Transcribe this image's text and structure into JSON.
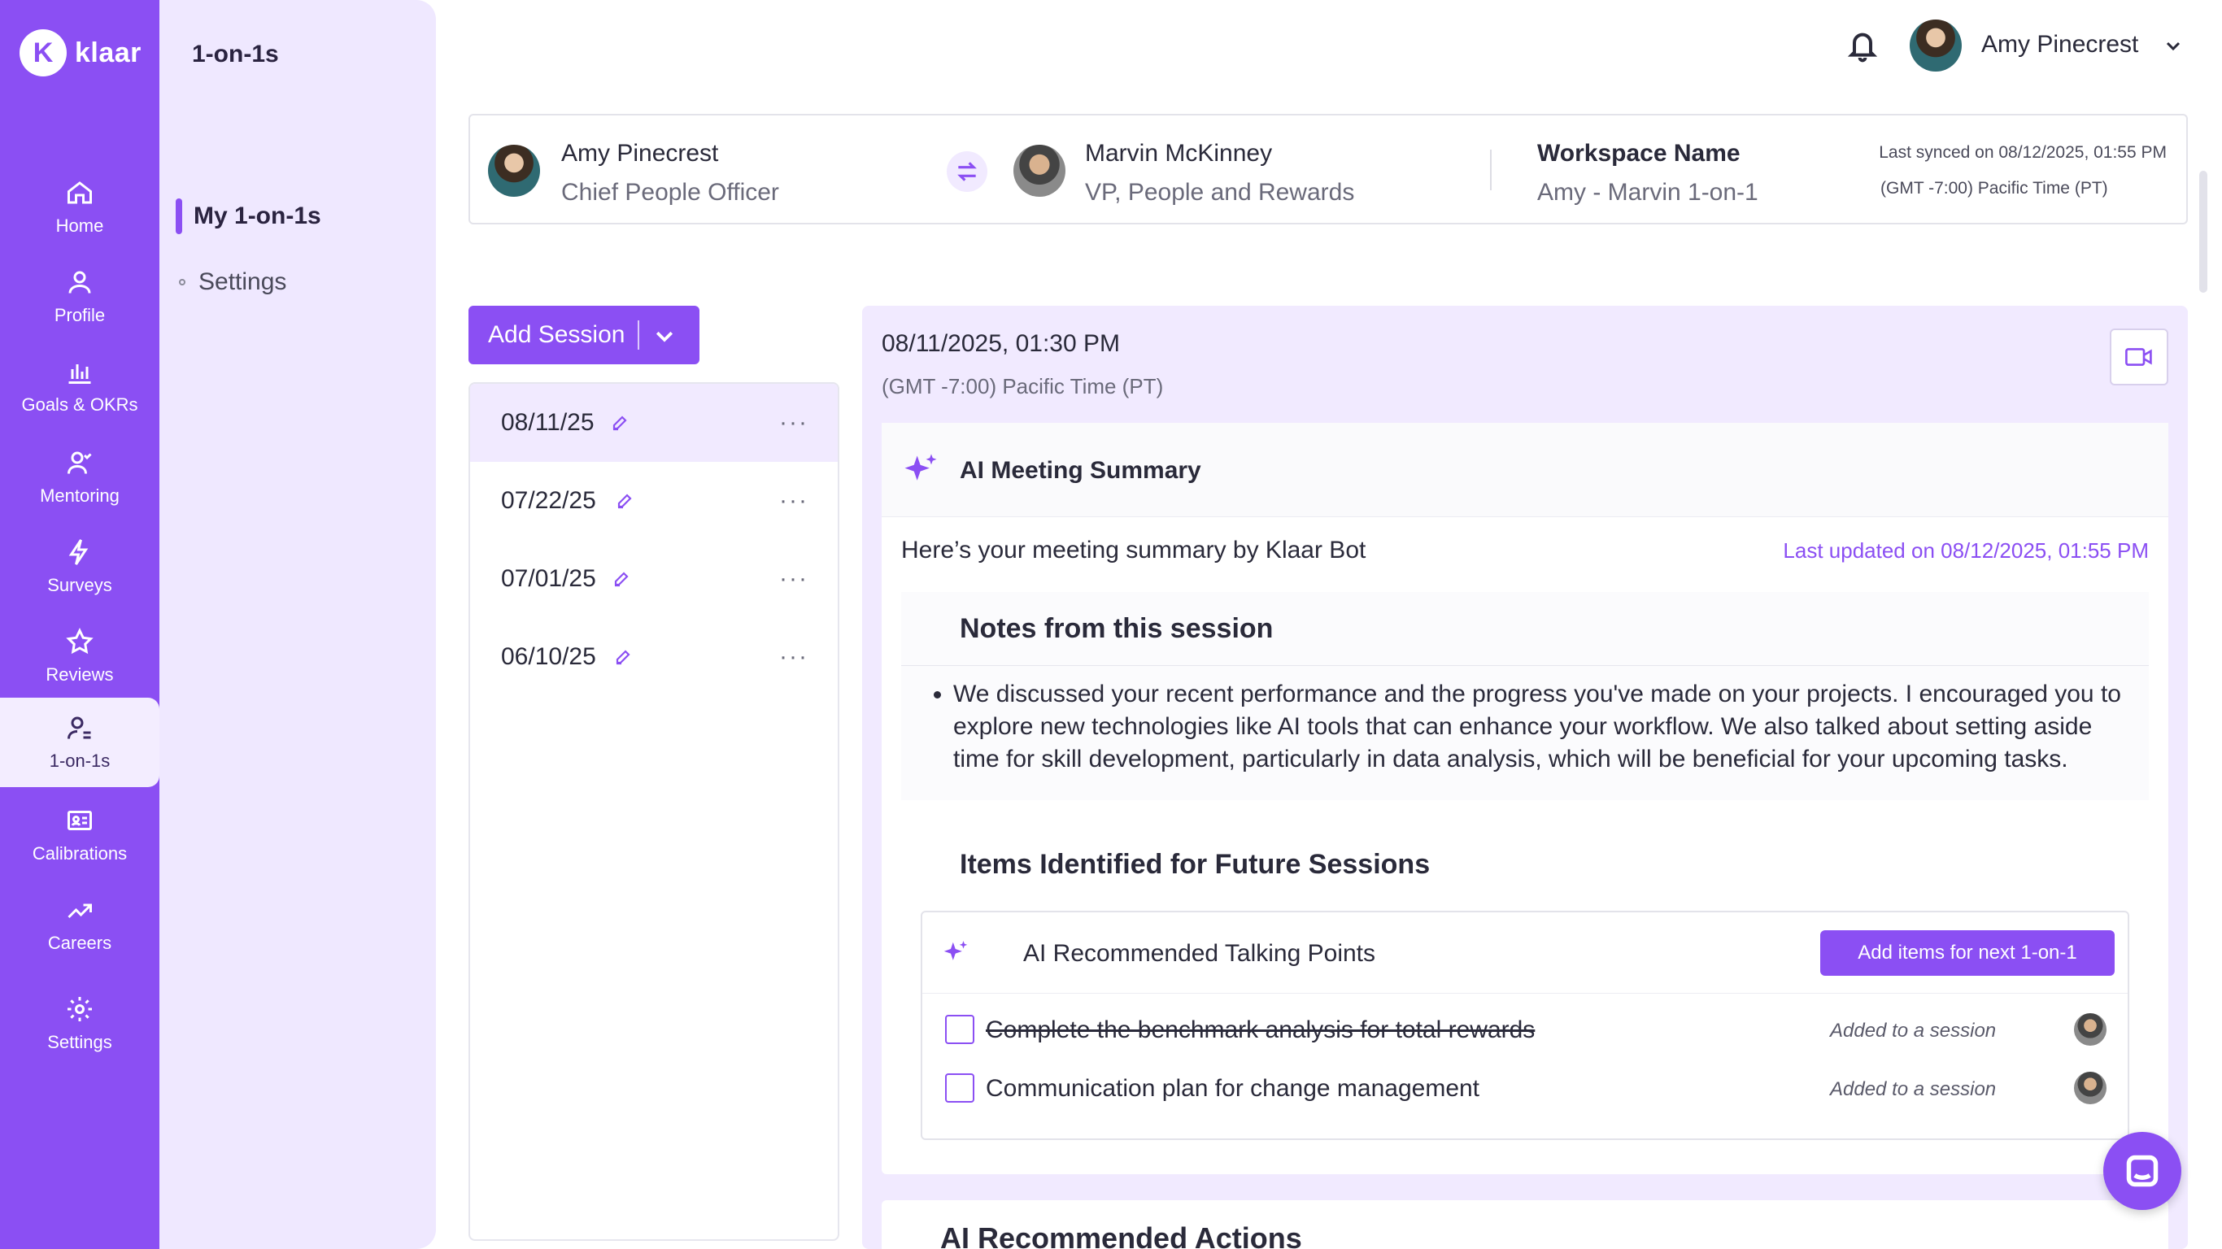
{
  "brand": {
    "logo_letter": "K",
    "name": "klaar",
    "accent": "#8b4ff3"
  },
  "nav": {
    "items": [
      {
        "label": "Home",
        "icon": "home-icon"
      },
      {
        "label": "Profile",
        "icon": "user-icon"
      },
      {
        "label": "Goals & OKRs",
        "icon": "bar-chart-icon"
      },
      {
        "label": "Mentoring",
        "icon": "mentoring-icon"
      },
      {
        "label": "Surveys",
        "icon": "lightning-icon"
      },
      {
        "label": "Reviews",
        "icon": "star-icon"
      },
      {
        "label": "1-on-1s",
        "icon": "one-on-one-icon",
        "active": true
      },
      {
        "label": "Calibrations",
        "icon": "id-card-icon"
      },
      {
        "label": "Careers",
        "icon": "trend-up-icon"
      },
      {
        "label": "Settings",
        "icon": "gear-icon"
      }
    ]
  },
  "subnav": {
    "title": "1-on-1s",
    "active_item": "My 1-on-1s",
    "item": "Settings"
  },
  "topbar": {
    "user_name": "Amy Pinecrest"
  },
  "participants": {
    "a_name": "Amy Pinecrest",
    "a_role": "Chief People Officer",
    "b_name": "Marvin McKinney",
    "b_role": "VP, People and Rewards",
    "workspace_label": "Workspace Name",
    "workspace_value": "Amy - Marvin 1-on-1",
    "last_synced": "Last synced on 08/12/2025, 01:55 PM",
    "timezone": "(GMT -7:00) Pacific Time (PT)"
  },
  "add_session_label": "Add Session",
  "sessions": [
    {
      "date": "08/11/25",
      "active": true
    },
    {
      "date": "07/22/25"
    },
    {
      "date": "07/01/25"
    },
    {
      "date": "06/10/25"
    }
  ],
  "detail": {
    "datetime": "08/11/2025, 01:30 PM",
    "timezone": "(GMT -7:00) Pacific Time (PT)",
    "summary_title": "AI Meeting Summary",
    "intro": "Here’s your meeting summary by Klaar Bot",
    "updated": "Last updated on 08/12/2025, 01:55 PM",
    "notes_title": "Notes from this session",
    "notes": "We discussed your recent performance and the progress you've made on your projects. I encouraged you to explore new technologies like AI tools that can enhance your workflow. We also talked about setting aside time for skill development, particularly in data analysis, which will be beneficial for your upcoming tasks.",
    "future_title": "Items Identified for Future Sessions",
    "talking_title": "AI Recommended Talking Points",
    "add_items_label": "Add items for next 1-on-1",
    "talking_points": [
      {
        "text": "Complete the benchmark analysis for total rewards",
        "status": "Added to a session",
        "done": true
      },
      {
        "text": "Communication plan for change management",
        "status": "Added to a session",
        "done": false
      }
    ],
    "actions_title": "AI Recommended Actions"
  }
}
